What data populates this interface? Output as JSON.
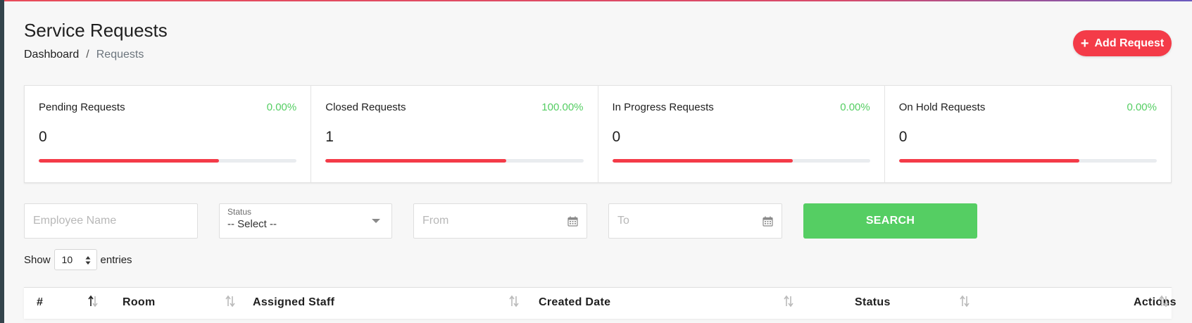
{
  "page": {
    "title": "Service Requests",
    "breadcrumb": {
      "home": "Dashboard",
      "separator": "/",
      "current": "Requests"
    }
  },
  "add_button": {
    "icon": "plus-icon",
    "label": "Add Request"
  },
  "colors": {
    "accent": "#f43b48",
    "success": "#55ce63",
    "sidebar": "#34444c"
  },
  "stats": [
    {
      "title": "Pending Requests",
      "percent": "0.00%",
      "value": "0",
      "progress": 0.7
    },
    {
      "title": "Closed Requests",
      "percent": "100.00%",
      "value": "1",
      "progress": 0.7
    },
    {
      "title": "In Progress Requests",
      "percent": "0.00%",
      "value": "0",
      "progress": 0.7
    },
    {
      "title": "On Hold Requests",
      "percent": "0.00%",
      "value": "0",
      "progress": 0.7
    }
  ],
  "filters": {
    "employee_name": {
      "placeholder": "Employee Name",
      "value": ""
    },
    "status": {
      "label": "Status",
      "value": "-- Select --"
    },
    "from": {
      "placeholder": "From",
      "icon": "calendar-icon"
    },
    "to": {
      "placeholder": "To",
      "icon": "calendar-icon"
    },
    "search_label": "SEARCH"
  },
  "entries": {
    "prefix": "Show",
    "value": "10",
    "suffix": "entries"
  },
  "table": {
    "columns": [
      "#",
      "Room",
      "Assigned Staff",
      "Created Date",
      "Status",
      "Actions"
    ]
  }
}
